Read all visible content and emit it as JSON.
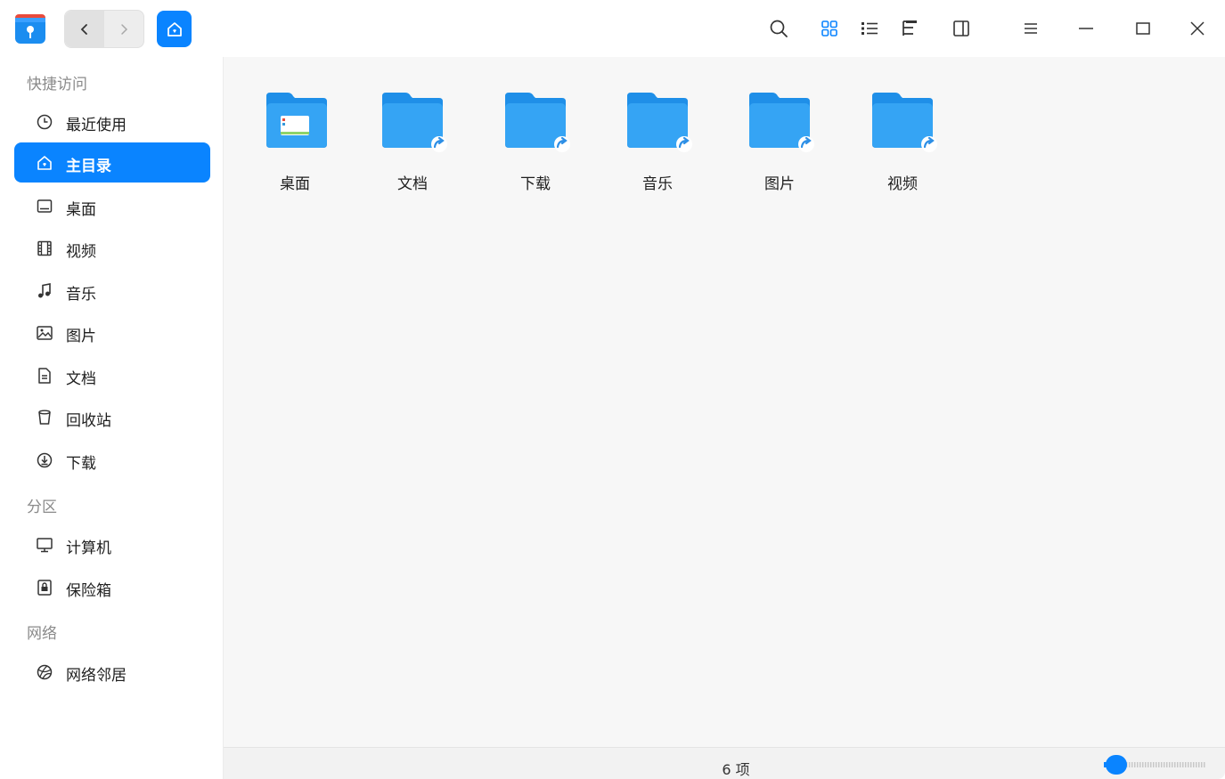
{
  "titlebar": {
    "nav_back_icon": "chevron-left-icon",
    "nav_forward_icon": "chevron-right-icon",
    "breadcrumb_icon": "home-icon"
  },
  "sidebar": {
    "sections": [
      {
        "title": "快捷访问",
        "items": [
          {
            "label": "最近使用",
            "icon": "clock-icon"
          },
          {
            "label": "主目录",
            "icon": "home-icon",
            "active": true
          },
          {
            "label": "桌面",
            "icon": "desktop-icon"
          },
          {
            "label": "视频",
            "icon": "film-icon"
          },
          {
            "label": "音乐",
            "icon": "music-icon"
          },
          {
            "label": "图片",
            "icon": "image-icon"
          },
          {
            "label": "文档",
            "icon": "document-icon"
          },
          {
            "label": "回收站",
            "icon": "trash-icon"
          },
          {
            "label": "下载",
            "icon": "download-icon"
          }
        ]
      },
      {
        "title": "分区",
        "items": [
          {
            "label": "计算机",
            "icon": "computer-icon"
          },
          {
            "label": "保险箱",
            "icon": "vault-icon"
          }
        ]
      },
      {
        "title": "网络",
        "items": [
          {
            "label": "网络邻居",
            "icon": "network-icon"
          }
        ]
      }
    ]
  },
  "main": {
    "files": [
      {
        "label": "桌面",
        "icon": "desktop-folder-icon",
        "shortcut": false
      },
      {
        "label": "文档",
        "icon": "folder-link-icon",
        "shortcut": true
      },
      {
        "label": "下载",
        "icon": "folder-link-icon",
        "shortcut": true
      },
      {
        "label": "音乐",
        "icon": "folder-link-icon",
        "shortcut": true
      },
      {
        "label": "图片",
        "icon": "folder-link-icon",
        "shortcut": true
      },
      {
        "label": "视频",
        "icon": "folder-link-icon",
        "shortcut": true
      }
    ]
  },
  "statusbar": {
    "item_count": "6 项",
    "zoom_level": 0.05
  },
  "colors": {
    "accent": "#0a84ff",
    "folder": "#2d9bef",
    "sidebar_bg": "#ffffff",
    "main_bg": "#f7f7f7"
  }
}
